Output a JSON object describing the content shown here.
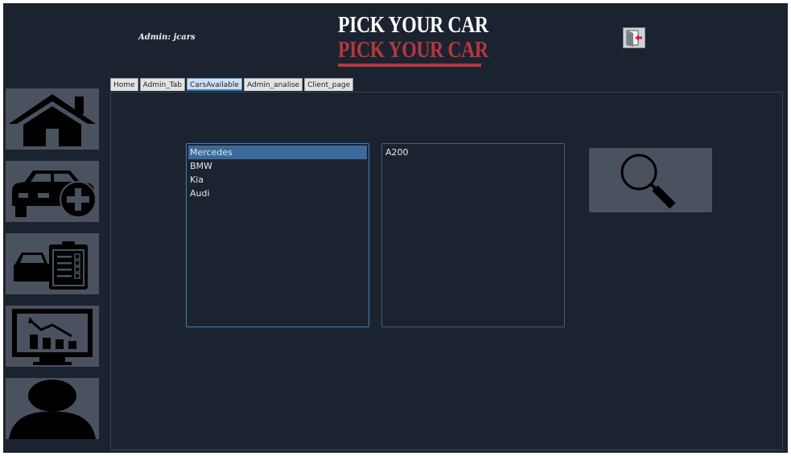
{
  "header": {
    "admin_label": "Admin: jcars",
    "logo_top": "PICK YOUR CAR",
    "logo_bottom": "PICK YOUR CAR",
    "logout_icon": "logout-door-icon"
  },
  "sidebar": {
    "items": [
      {
        "name": "home",
        "icon": "home-icon"
      },
      {
        "name": "add-car",
        "icon": "car-add-icon"
      },
      {
        "name": "car-report",
        "icon": "car-clipboard-icon"
      },
      {
        "name": "analytics",
        "icon": "monitor-chart-icon"
      },
      {
        "name": "user",
        "icon": "user-icon"
      }
    ]
  },
  "tabs": [
    {
      "label": "Home",
      "active": false
    },
    {
      "label": "Admin_Tab",
      "active": false
    },
    {
      "label": "CarsAvailable",
      "active": true
    },
    {
      "label": "Admin_analise",
      "active": false
    },
    {
      "label": "Client_page",
      "active": false
    }
  ],
  "brands_list": {
    "items": [
      "Mercedes",
      "BMW",
      "Kia",
      "Audi"
    ],
    "selected": "Mercedes"
  },
  "models_list": {
    "items": [
      "A200"
    ]
  },
  "search": {
    "icon": "search-icon"
  },
  "colors": {
    "background": "#1c2330",
    "panel_button": "#4a5260",
    "logo_red": "#b5383e",
    "selection": "#3a6a9c"
  }
}
